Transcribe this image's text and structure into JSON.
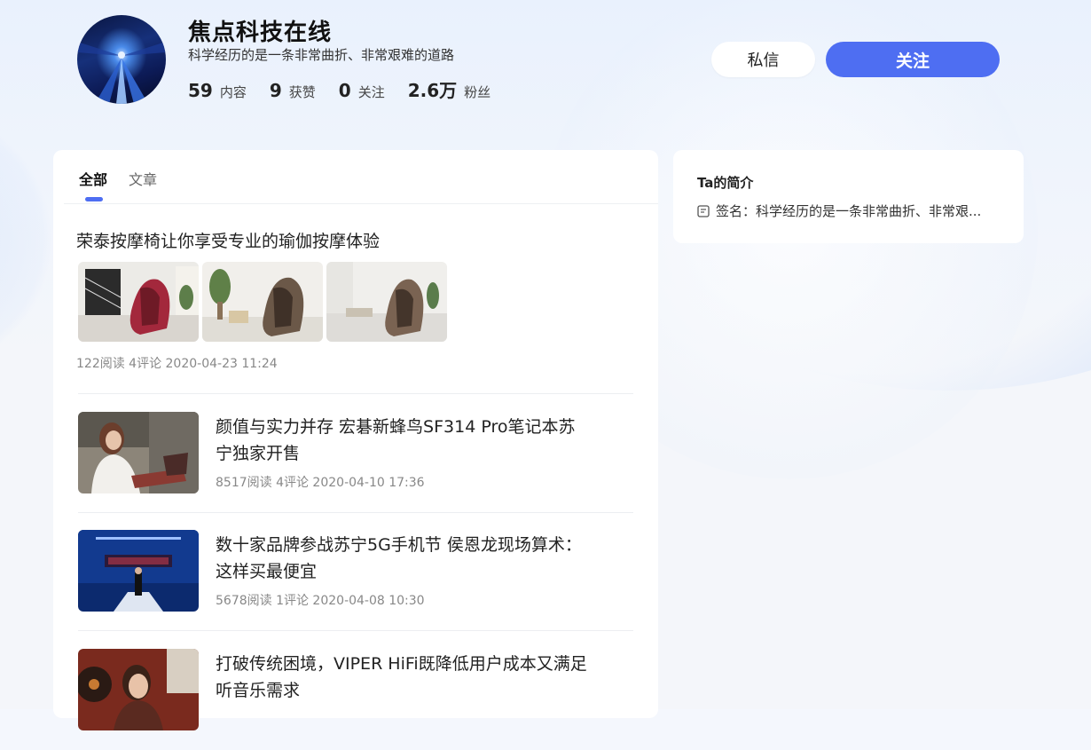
{
  "profile": {
    "name": "焦点科技在线",
    "signature": "科学经历的是一条非常曲折、非常艰难的道路",
    "stats": [
      {
        "num": "59",
        "label": "内容"
      },
      {
        "num": "9",
        "label": "获赞"
      },
      {
        "num": "0",
        "label": "关注"
      },
      {
        "num": "2.6万",
        "label": "粉丝"
      }
    ]
  },
  "actions": {
    "message_label": "私信",
    "follow_label": "关注"
  },
  "tabs": [
    "全部",
    "文章"
  ],
  "feed": [
    {
      "title": "荣泰按摩椅让你享受专业的瑜伽按摩体验",
      "meta": "122阅读  4评论  2020-04-23 11:24"
    },
    {
      "title": "颜值与实力并存 宏碁新蜂鸟SF314 Pro笔记本苏宁独家开售",
      "meta": "8517阅读  4评论  2020-04-10 17:36"
    },
    {
      "title": "数十家品牌参战苏宁5G手机节 侯恩龙现场算术：这样买最便宜",
      "meta": "5678阅读  1评论  2020-04-08 10:30"
    },
    {
      "title": "打破传统困境，VIPER HiFi既降低用户成本又满足听音乐需求",
      "meta": ""
    }
  ],
  "intro": {
    "heading": "Ta的简介",
    "signature_line": "签名：科学经历的是一条非常曲折、非常艰..."
  },
  "colors": {
    "accent": "#4e6ef2"
  }
}
